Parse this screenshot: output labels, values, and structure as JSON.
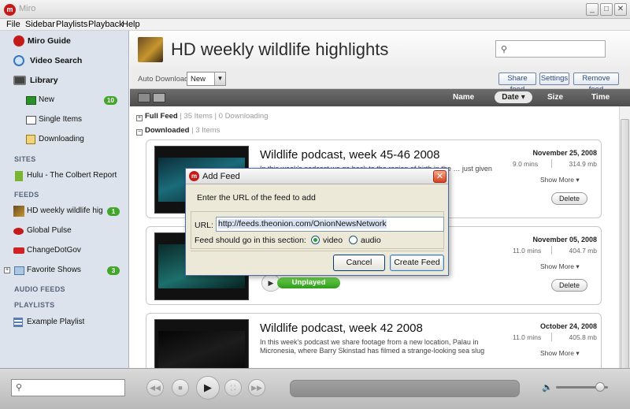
{
  "window": {
    "title": "Miro",
    "logo_glyph": "m",
    "minimize": "_",
    "maximize": "□",
    "close": "✕"
  },
  "menu": [
    "File",
    "Sidebar",
    "Playlists",
    "Playback",
    "Help"
  ],
  "sidebar": {
    "top_items": [
      {
        "label": "Miro Guide",
        "icon": "miro-logo-icon"
      },
      {
        "label": "Video Search",
        "icon": "search-icon"
      },
      {
        "label": "Library",
        "icon": "tv-icon"
      }
    ],
    "library_items": [
      {
        "label": "New",
        "badge": "10"
      },
      {
        "label": "Single Items",
        "badge": ""
      },
      {
        "label": "Downloading",
        "badge": ""
      }
    ],
    "sites_heading": "SITES",
    "sites": [
      {
        "label": "Hulu - The Colbert Report"
      }
    ],
    "feeds_heading": "FEEDS",
    "feeds": [
      {
        "label": "HD weekly wildlife highligh",
        "badge": "1"
      },
      {
        "label": "Global Pulse",
        "badge": ""
      },
      {
        "label": "ChangeDotGov",
        "badge": ""
      },
      {
        "label": "Favorite Shows",
        "badge": "3"
      }
    ],
    "audio_feeds_heading": "AUDIO FEEDS",
    "playlists_heading": "PLAYLISTS",
    "playlists": [
      {
        "label": "Example Playlist"
      }
    ]
  },
  "feed": {
    "title": "HD weekly wildlife highlights",
    "auto_download_label": "Auto Download",
    "auto_download_value": "New",
    "buttons": {
      "share": "Share feed",
      "settings": "Settings",
      "remove": "Remove feed"
    }
  },
  "sort_columns": {
    "name": "Name",
    "date": "Date ▾",
    "size": "Size",
    "time": "Time"
  },
  "sections": {
    "full_feed": {
      "label": "Full Feed",
      "count": "35 Items",
      "downloading": "0 Downloading"
    },
    "downloaded": {
      "label": "Downloaded",
      "count": "3 Items"
    }
  },
  "items": [
    {
      "title": "Wildlife podcast, week 45-46 2008",
      "desc": "In this week's podcast we go back to the region of birth in the … just given birth to",
      "date": "November 25, 2008",
      "mins": "9.0 mins",
      "size": "314.9 mb",
      "show_more": "Show More ▾",
      "delete": "Delete",
      "status": ""
    },
    {
      "title": "",
      "desc": "… uane filmed an … 's off to the",
      "date": "November 05, 2008",
      "mins": "11.0 mins",
      "size": "404.7 mb",
      "show_more": "Show More ▾",
      "delete": "Delete",
      "status": "Unplayed"
    },
    {
      "title": "Wildlife podcast, week 42 2008",
      "desc": "In this week's podcast we share footage from a new location, Palau in Micronesia, where Barry Skinstad has filmed a strange-looking sea slug among",
      "date": "October 24, 2008",
      "mins": "11.0 mins",
      "size": "405.8 mb",
      "show_more": "Show More ▾",
      "delete": "",
      "status": ""
    }
  ],
  "dialog": {
    "title": "Add Feed",
    "prompt": "Enter the URL of the feed to add",
    "url_label": "URL:",
    "url_value": "http://feeds.theonion.com/OnionNewsNetwork",
    "section_label": "Feed should go in this section:",
    "option_video": "video",
    "option_audio": "audio",
    "selected": "video",
    "cancel": "Cancel",
    "create": "Create Feed"
  },
  "player": {
    "controls": [
      "◀◀",
      "■",
      "▶",
      "⛶",
      "▶▶"
    ],
    "volume_icon": "🔈",
    "volume_level": 0.85
  },
  "colors": {
    "accent_green": "#43a62b",
    "brand_red": "#c31a1a",
    "sidebar_bg": "#dde3ec"
  }
}
